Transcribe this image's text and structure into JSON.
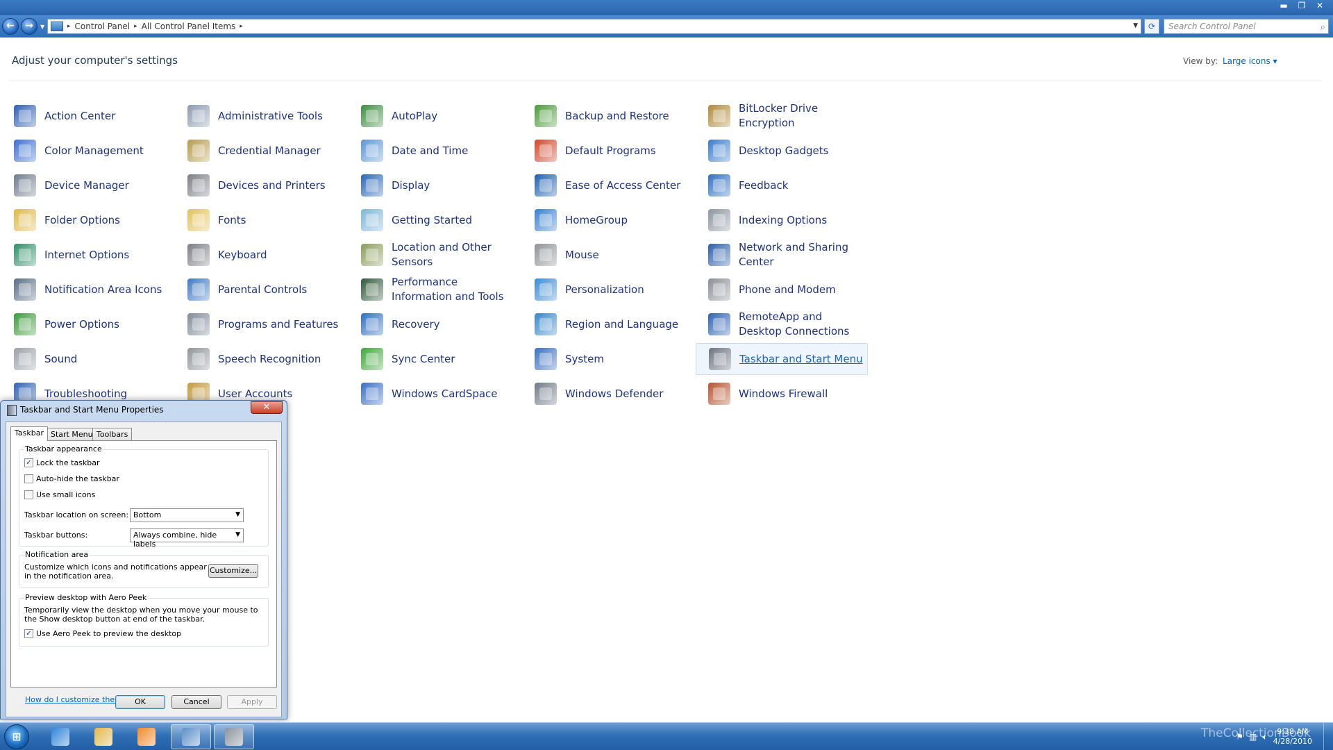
{
  "window": {
    "controls": {
      "minimize": "▬",
      "maximize": "❐",
      "close": "✕"
    }
  },
  "nav": {
    "back": "←",
    "forward": "→",
    "breadcrumbs": [
      "Control Panel",
      "All Control Panel Items"
    ],
    "search_placeholder": "Search Control Panel"
  },
  "header": {
    "title": "Adjust your computer's settings",
    "view_by_label": "View by:",
    "view_by_value": "Large icons ▾"
  },
  "items": [
    {
      "label": "Action Center",
      "icon": "action-center-flag-icon",
      "color": "#2f5fb3"
    },
    {
      "label": "Administrative Tools",
      "icon": "admin-tools-icon",
      "color": "#8a9bb0"
    },
    {
      "label": "AutoPlay",
      "icon": "autoplay-icon",
      "color": "#3d8c40"
    },
    {
      "label": "Backup and Restore",
      "icon": "backup-restore-icon",
      "color": "#4a9a3a"
    },
    {
      "label": "BitLocker Drive Encryption",
      "icon": "bitlocker-key-icon",
      "color": "#b08a3a"
    },
    {
      "label": "Color Management",
      "icon": "color-management-icon",
      "color": "#3b6fd1"
    },
    {
      "label": "Credential Manager",
      "icon": "credential-manager-icon",
      "color": "#b69a4a"
    },
    {
      "label": "Date and Time",
      "icon": "date-time-icon",
      "color": "#5d95d6"
    },
    {
      "label": "Default Programs",
      "icon": "default-programs-icon",
      "color": "#d0452a"
    },
    {
      "label": "Desktop Gadgets",
      "icon": "desktop-gadgets-icon",
      "color": "#3a7cc9"
    },
    {
      "label": "Device Manager",
      "icon": "device-manager-icon",
      "color": "#6f7d8c"
    },
    {
      "label": "Devices and Printers",
      "icon": "printer-icon",
      "color": "#7a7f86"
    },
    {
      "label": "Display",
      "icon": "display-monitor-icon",
      "color": "#2a66b8"
    },
    {
      "label": "Ease of Access Center",
      "icon": "ease-of-access-icon",
      "color": "#1f5fb0"
    },
    {
      "label": "Feedback",
      "icon": "feedback-bubble-icon",
      "color": "#2f6fc2"
    },
    {
      "label": "Folder Options",
      "icon": "folder-options-icon",
      "color": "#e0b84a"
    },
    {
      "label": "Fonts",
      "icon": "fonts-folder-icon",
      "color": "#e3c25a"
    },
    {
      "label": "Getting Started",
      "icon": "getting-started-icon",
      "color": "#7fb5d8"
    },
    {
      "label": "HomeGroup",
      "icon": "homegroup-icon",
      "color": "#3a7fd0"
    },
    {
      "label": "Indexing Options",
      "icon": "indexing-options-icon",
      "color": "#8c959e"
    },
    {
      "label": "Internet Options",
      "icon": "internet-options-globe-icon",
      "color": "#2f8f6a"
    },
    {
      "label": "Keyboard",
      "icon": "keyboard-icon",
      "color": "#7b7f85"
    },
    {
      "label": "Location and Other Sensors",
      "icon": "location-sensors-icon",
      "color": "#8a9d5a"
    },
    {
      "label": "Mouse",
      "icon": "mouse-icon",
      "color": "#8d9196"
    },
    {
      "label": "Network and Sharing Center",
      "icon": "network-sharing-icon",
      "color": "#2b5fa8"
    },
    {
      "label": "Notification Area Icons",
      "icon": "notification-area-icon",
      "color": "#5a6e86"
    },
    {
      "label": "Parental Controls",
      "icon": "parental-controls-icon",
      "color": "#3f7ac2"
    },
    {
      "label": "Performance Information and Tools",
      "icon": "performance-meter-icon",
      "color": "#2f5a3a"
    },
    {
      "label": "Personalization",
      "icon": "personalization-icon",
      "color": "#3b8ad3"
    },
    {
      "label": "Phone and Modem",
      "icon": "phone-modem-icon",
      "color": "#8a8f96"
    },
    {
      "label": "Power Options",
      "icon": "power-options-icon",
      "color": "#3d9a3d"
    },
    {
      "label": "Programs and Features",
      "icon": "programs-features-icon",
      "color": "#7f8a99"
    },
    {
      "label": "Recovery",
      "icon": "recovery-icon",
      "color": "#2f6fc0"
    },
    {
      "label": "Region and Language",
      "icon": "region-language-globe-icon",
      "color": "#3587c9"
    },
    {
      "label": "RemoteApp and Desktop Connections",
      "icon": "remoteapp-icon",
      "color": "#2d62b3"
    },
    {
      "label": "Sound",
      "icon": "sound-speaker-icon",
      "color": "#9aa1a8"
    },
    {
      "label": "Speech Recognition",
      "icon": "microphone-icon",
      "color": "#8f959b"
    },
    {
      "label": "Sync Center",
      "icon": "sync-center-icon",
      "color": "#3fa63a"
    },
    {
      "label": "System",
      "icon": "system-icon",
      "color": "#3a6fbf"
    },
    {
      "label": "Taskbar and Start Menu",
      "icon": "taskbar-start-menu-icon",
      "color": "#6a7480"
    },
    {
      "label": "Troubleshooting",
      "icon": "troubleshooting-icon",
      "color": "#2f63b5"
    },
    {
      "label": "User Accounts",
      "icon": "user-accounts-icon",
      "color": "#c39a3a"
    },
    {
      "label": "Windows CardSpace",
      "icon": "cardspace-icon",
      "color": "#3a6fc4"
    },
    {
      "label": "Windows Defender",
      "icon": "windows-defender-icon",
      "color": "#6f7a86"
    },
    {
      "label": "Windows Firewall",
      "icon": "windows-firewall-icon",
      "color": "#b5532e"
    }
  ],
  "selected_item": "Taskbar and Start Menu",
  "dialog": {
    "title": "Taskbar and Start Menu Properties",
    "close": "✕",
    "tabs": [
      "Taskbar",
      "Start Menu",
      "Toolbars"
    ],
    "active_tab": "Taskbar",
    "appearance": {
      "title": "Taskbar appearance",
      "lock": {
        "label": "Lock the taskbar",
        "checked": true
      },
      "autohide": {
        "label": "Auto-hide the taskbar",
        "checked": false
      },
      "small_icons": {
        "label": "Use small icons",
        "checked": false
      },
      "location_label": "Taskbar location on screen:",
      "location_value": "Bottom",
      "buttons_label": "Taskbar buttons:",
      "buttons_value": "Always combine, hide labels"
    },
    "notification": {
      "title": "Notification area",
      "text": "Customize which icons and notifications appear in the notification area.",
      "customize": "Customize..."
    },
    "aero_peek": {
      "title": "Preview desktop with Aero Peek",
      "text": "Temporarily view the desktop when you move your mouse to the Show desktop button at end of the taskbar.",
      "checkbox": {
        "label": "Use Aero Peek to preview the desktop",
        "checked": true
      }
    },
    "help_link": "How do I customize the taskbar?",
    "ok": "OK",
    "cancel": "Cancel",
    "apply": "Apply"
  },
  "taskbar": {
    "start": "⊞",
    "pinned": [
      {
        "name": "internet-explorer-icon",
        "color": "#2f86d8"
      },
      {
        "name": "windows-explorer-icon",
        "color": "#e2b84c"
      },
      {
        "name": "media-player-icon",
        "color": "#f08a2a"
      },
      {
        "name": "control-panel-icon",
        "color": "#5b8fc8"
      },
      {
        "name": "taskbar-properties-icon",
        "color": "#8a939e"
      }
    ],
    "tray_icons": [
      "flag-icon",
      "network-icon",
      "volume-icon"
    ],
    "time": "9:38 AM",
    "date": "4/28/2010",
    "watermark": "TheCollectionBook"
  }
}
